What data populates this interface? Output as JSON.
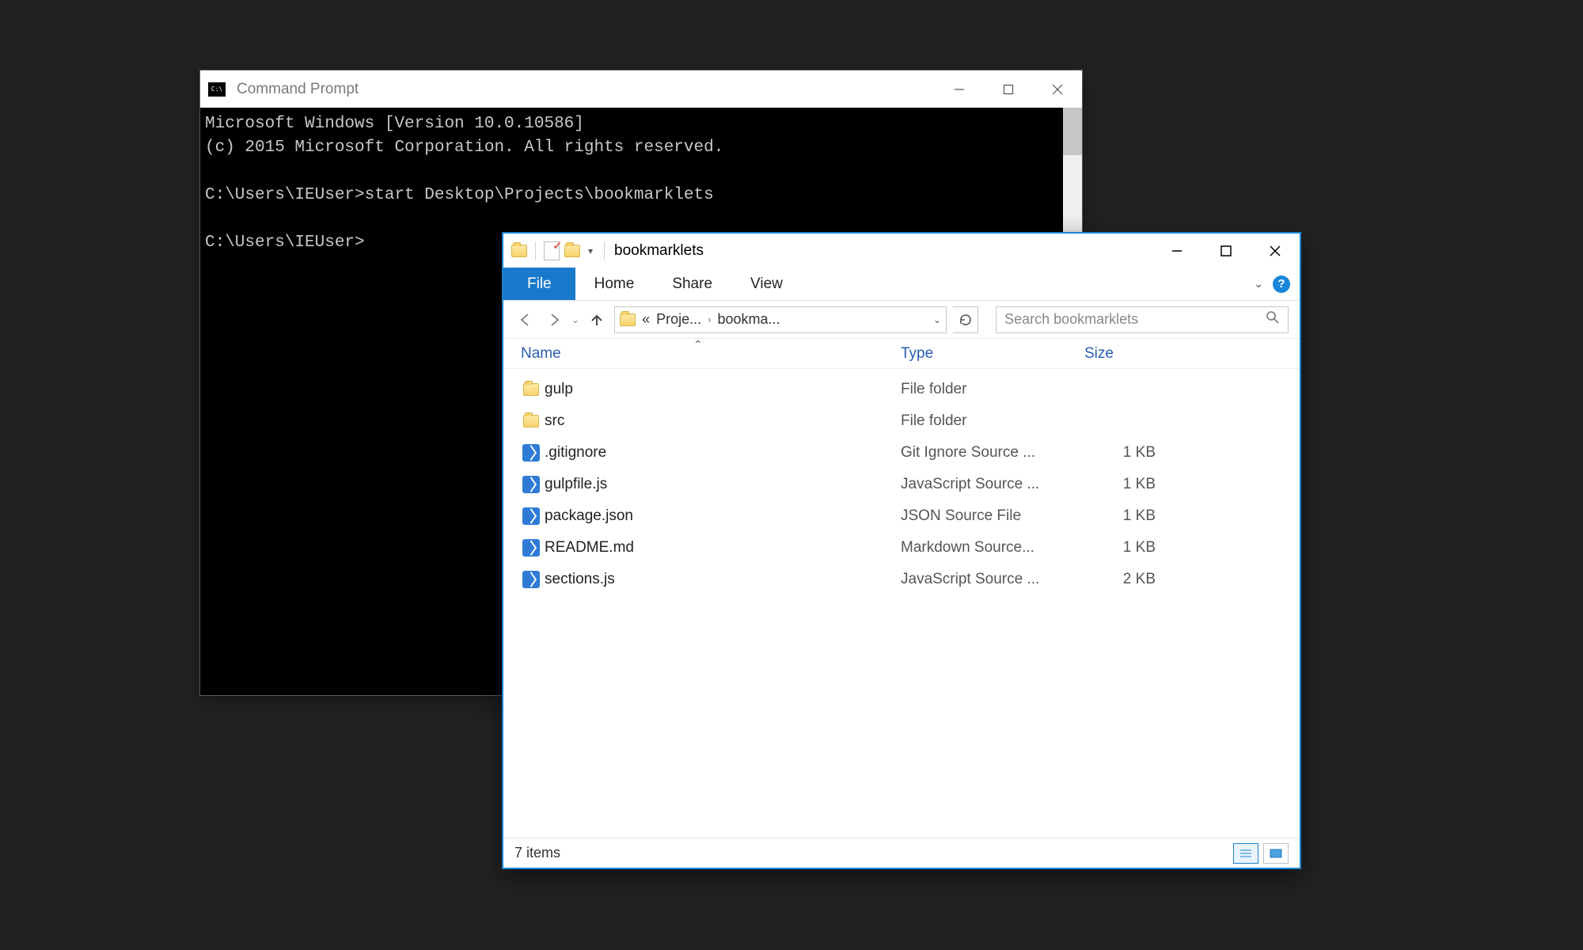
{
  "cmd": {
    "title": "Command Prompt",
    "lines": [
      "Microsoft Windows [Version 10.0.10586]",
      "(c) 2015 Microsoft Corporation. All rights reserved.",
      "",
      "C:\\Users\\IEUser>start Desktop\\Projects\\bookmarklets",
      "",
      "C:\\Users\\IEUser>"
    ]
  },
  "explorer": {
    "title": "bookmarklets",
    "tabs": {
      "file": "File",
      "home": "Home",
      "share": "Share",
      "view": "View"
    },
    "breadcrumb": {
      "prefix": "«",
      "seg1": "Proje...",
      "seg2": "bookma..."
    },
    "search_placeholder": "Search bookmarklets",
    "columns": {
      "name": "Name",
      "type": "Type",
      "size": "Size"
    },
    "files": [
      {
        "icon": "folder",
        "name": "gulp",
        "type": "File folder",
        "size": ""
      },
      {
        "icon": "folder",
        "name": "src",
        "type": "File folder",
        "size": ""
      },
      {
        "icon": "vs",
        "name": ".gitignore",
        "type": "Git Ignore Source ...",
        "size": "1 KB"
      },
      {
        "icon": "vs",
        "name": "gulpfile.js",
        "type": "JavaScript Source ...",
        "size": "1 KB"
      },
      {
        "icon": "vs",
        "name": "package.json",
        "type": "JSON Source File",
        "size": "1 KB"
      },
      {
        "icon": "vs",
        "name": "README.md",
        "type": "Markdown Source...",
        "size": "1 KB"
      },
      {
        "icon": "vs",
        "name": "sections.js",
        "type": "JavaScript Source ...",
        "size": "2 KB"
      }
    ],
    "status": "7 items"
  }
}
